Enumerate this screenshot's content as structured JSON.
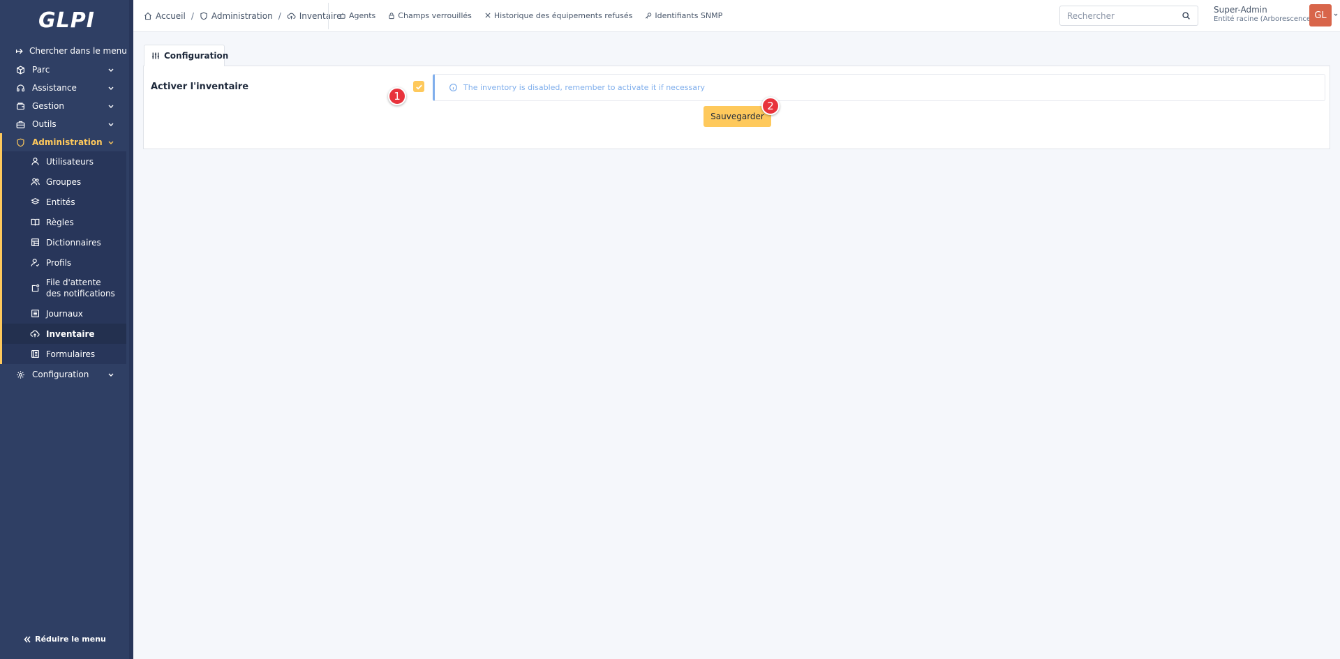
{
  "app": {
    "logo": "GLPI"
  },
  "sidebar": {
    "search_label": "Chercher dans le menu",
    "items": [
      {
        "label": "Parc",
        "icon": "box-icon"
      },
      {
        "label": "Assistance",
        "icon": "headset-icon"
      },
      {
        "label": "Gestion",
        "icon": "wallet-icon"
      },
      {
        "label": "Outils",
        "icon": "briefcase-icon"
      },
      {
        "label": "Administration",
        "icon": "shield-icon"
      },
      {
        "label": "Configuration",
        "icon": "gear-icon"
      }
    ],
    "admin_sub": [
      {
        "label": "Utilisateurs",
        "icon": "user-icon"
      },
      {
        "label": "Groupes",
        "icon": "users-icon"
      },
      {
        "label": "Entités",
        "icon": "stack-icon"
      },
      {
        "label": "Règles",
        "icon": "book-icon"
      },
      {
        "label": "Dictionnaires",
        "icon": "table-icon"
      },
      {
        "label": "Profils",
        "icon": "user-check-icon"
      },
      {
        "label": "File d'attente des notifications",
        "icon": "notification-icon"
      },
      {
        "label": "Journaux",
        "icon": "log-icon"
      },
      {
        "label": "Inventaire",
        "icon": "cloud-upload-icon"
      },
      {
        "label": "Formulaires",
        "icon": "forms-icon"
      }
    ],
    "reduce_label": "Réduire le menu"
  },
  "topbar": {
    "breadcrumb": [
      "Accueil",
      "Administration",
      "Inventaire"
    ],
    "tools": [
      "Agents",
      "Champs verrouillés",
      "Historique des équipements refusés",
      "Identifiants SNMP"
    ],
    "search_placeholder": "Rechercher",
    "user_name": "Super-Admin",
    "user_entity": "Entité racine (Arborescence)",
    "avatar_initials": "GL"
  },
  "main": {
    "tab_label": "Configuration",
    "field_label": "Activer l'inventaire",
    "checkbox_checked": true,
    "alert_text": "The inventory is disabled, remember to activate it if necessary",
    "save_label": "Sauvegarder",
    "markers": [
      "1",
      "2"
    ]
  },
  "colors": {
    "sidebar_bg": "#2f3f64",
    "accent": "#fec95c",
    "alert_blue": "#7faeec",
    "avatar_bg": "#d8654a",
    "marker_red": "#e8333c"
  }
}
